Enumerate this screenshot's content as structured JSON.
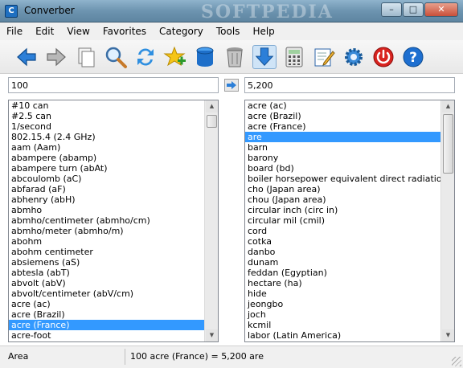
{
  "window": {
    "title": "Converber",
    "watermark": "SOFTPEDIA"
  },
  "menu": [
    "File",
    "Edit",
    "View",
    "Favorites",
    "Category",
    "Tools",
    "Help"
  ],
  "toolbar": [
    {
      "icon": "back-arrow-icon"
    },
    {
      "icon": "forward-arrow-icon"
    },
    {
      "icon": "copy-icon"
    },
    {
      "icon": "search-icon"
    },
    {
      "icon": "swap-icon"
    },
    {
      "icon": "add-favorite-icon"
    },
    {
      "icon": "database-icon"
    },
    {
      "icon": "trash-icon"
    },
    {
      "icon": "download-icon"
    },
    {
      "icon": "calculator-icon"
    },
    {
      "icon": "edit-icon"
    },
    {
      "icon": "settings-icon"
    },
    {
      "icon": "power-icon"
    },
    {
      "icon": "help-icon"
    }
  ],
  "input": {
    "from_value": "100",
    "to_value": "5,200"
  },
  "from_units": [
    "#10 can",
    "#2.5 can",
    "1/second",
    "802.15.4 (2.4 GHz)",
    "aam (Aam)",
    "abampere (abamp)",
    "abampere turn (abAt)",
    "abcoulomb (aC)",
    "abfarad (aF)",
    "abhenry (abH)",
    "abmho",
    "abmho/centimeter (abmho/cm)",
    "abmho/meter (abmho/m)",
    "abohm",
    "abohm centimeter",
    "absiemens (aS)",
    "abtesla (abT)",
    "abvolt (abV)",
    "abvolt/centimeter (abV/cm)",
    "acre (ac)",
    "acre (Brazil)",
    "acre (France)",
    "acre-foot"
  ],
  "from_selected": 21,
  "to_units": [
    "acre (ac)",
    "acre (Brazil)",
    "acre (France)",
    "are",
    "barn",
    "barony",
    "board (bd)",
    "boiler horsepower equivalent direct radiation",
    "cho (Japan area)",
    "chou (Japan area)",
    "circular inch (circ in)",
    "circular mil (cmil)",
    "cord",
    "cotka",
    "danbo",
    "dunam",
    "feddan (Egyptian)",
    "hectare (ha)",
    "hide",
    "jeongbo",
    "joch",
    "kcmil",
    "labor (Latin America)"
  ],
  "to_selected": 3,
  "status": {
    "category": "Area",
    "result": "100 acre (France) = 5,200 are"
  },
  "colors": {
    "selection": "#3399ff",
    "titlebar": "#6d94b0"
  }
}
